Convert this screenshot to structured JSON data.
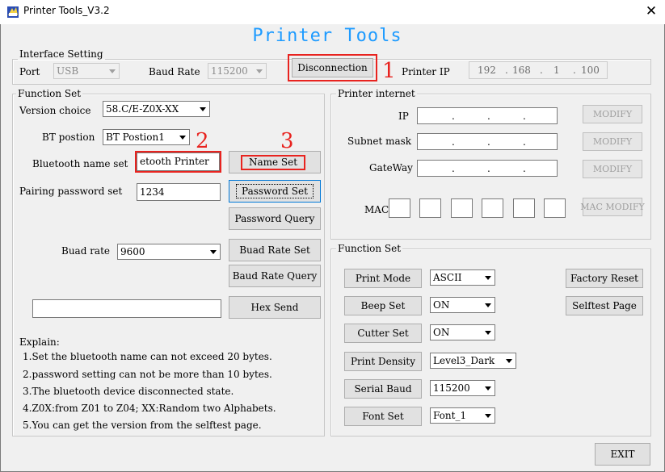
{
  "window": {
    "title": "Printer Tools_V3.2",
    "close_glyph": "✕",
    "icon": "printer-app-icon"
  },
  "heading": "Printer Tools",
  "interface_setting": {
    "legend": "Interface Setting",
    "port_label": "Port",
    "port_value": "USB",
    "baud_label": "Baud Rate",
    "baud_value": "115200",
    "disconnect_label": "Disconnection",
    "printer_ip_label": "Printer IP",
    "printer_ip": [
      "192",
      "168",
      "1",
      "100"
    ]
  },
  "function_set_left": {
    "legend": "Function Set",
    "version_label": "Version choice",
    "version_value": "58.C/E-Z0X-XX",
    "bt_position_label": "BT postion",
    "bt_position_value": "BT Postion1",
    "bt_name_label": "Bluetooth name set",
    "bt_name_value": "etooth Printer",
    "name_set_label": "Name Set",
    "pairing_label": "Pairing password set",
    "pairing_value": "1234",
    "password_set_label": "Password Set",
    "password_query_label": "Password Query",
    "buad_rate_label": "Buad rate",
    "buad_rate_value": "9600",
    "buad_rate_set_label": "Buad Rate Set",
    "baud_rate_query_label": "Baud Rate Query",
    "hex_value": "",
    "hex_send_label": "Hex Send",
    "explain_title": "Explain:",
    "explain_lines": [
      "1.Set the bluetooth name can not exceed 20 bytes.",
      "2.password setting can not be more than 10 bytes.",
      "3.The bluetooth device disconnected state.",
      "4.Z0X:from Z01 to Z04; XX:Random two Alphabets.",
      "5.You can get the version from the selftest page."
    ]
  },
  "printer_internet": {
    "legend": "Printer internet",
    "ip_label": "IP",
    "subnet_label": "Subnet mask",
    "gateway_label": "GateWay",
    "mac_label": "MAC",
    "dot": ".",
    "modify_label": "MODIFY",
    "mac_modify_label": "MAC MODIFY"
  },
  "function_set_right": {
    "legend": "Function Set",
    "print_mode_label": "Print Mode",
    "print_mode_value": "ASCII",
    "beep_label": "Beep Set",
    "beep_value": "ON",
    "cutter_label": "Cutter Set",
    "cutter_value": "ON",
    "density_label": "Print Density",
    "density_value": "Level3_Dark",
    "serial_label": "Serial Baud",
    "serial_value": "115200",
    "font_label": "Font Set",
    "font_value": "Font_1",
    "factory_reset_label": "Factory Reset",
    "selftest_label": "Selftest Page"
  },
  "exit_label": "EXIT",
  "annotations": {
    "n1": "1",
    "n2": "2",
    "n3": "3",
    "color": "#e8231f"
  },
  "colors": {
    "heading": "#1e9bff",
    "focus_border": "#0078d7"
  }
}
